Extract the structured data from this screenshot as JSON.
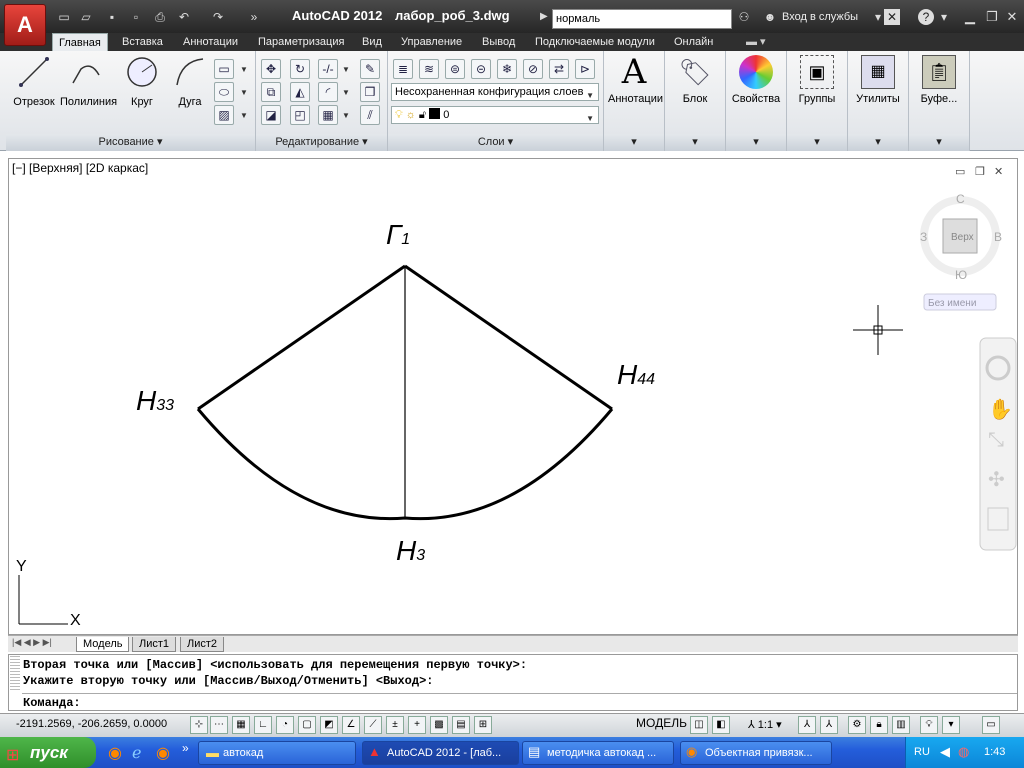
{
  "window": {
    "app_title": "AutoCAD 2012",
    "doc_title": "лабор_роб_3.dwg",
    "search_value": "нормаль",
    "login_label": "Вход в службы"
  },
  "tabs": [
    "Главная",
    "Вставка",
    "Аннотации",
    "Параметризация",
    "Вид",
    "Управление",
    "Вывод",
    "Подключаемые модули",
    "Онлайн"
  ],
  "draw_panel": {
    "title": "Рисование",
    "line": "Отрезок",
    "polyline": "Полилиния",
    "circle": "Круг",
    "arc": "Дуга"
  },
  "modify_panel": {
    "title": "Редактирование"
  },
  "layers_panel": {
    "title": "Слои",
    "layer_state": "Несохраненная конфигурация слоев",
    "current_layer": "0"
  },
  "big_buttons": {
    "annotation": "Аннотации",
    "block": "Блок",
    "properties": "Свойства",
    "groups": "Группы",
    "utilities": "Утилиты",
    "clipboard": "Буфе..."
  },
  "viewport": {
    "label": "[−] [Верхняя] [2D каркас]",
    "viewcube_top": "Верх",
    "north": "С",
    "south": "Ю",
    "west": "З",
    "east": "В",
    "ucs_name": "Без имени"
  },
  "drawing": {
    "label_top": "Г",
    "label_top_sub": "1",
    "label_left": "Н",
    "label_left_sub": "33",
    "label_right": "Н",
    "label_right_sub": "44",
    "label_bottom": "Н",
    "label_bottom_sub": "3",
    "ucs_y": "Y",
    "ucs_x": "X"
  },
  "layout_tabs": [
    "Модель",
    "Лист1",
    "Лист2"
  ],
  "command": {
    "line1": "Вторая точка или [Массив] <использовать для перемещения первую точку>:",
    "line2": "Укажите вторую точку или [Массив/Выход/Отменить] <Выход>:",
    "prompt": "Команда:"
  },
  "status": {
    "coords": "-2191.2569, -206.2659, 0.0000",
    "model": "МОДЕЛЬ",
    "scale": "1:1"
  },
  "taskbar": {
    "start": "пуск",
    "items": [
      "автокад",
      "AutoCAD 2012 - [лаб...",
      "методичка автокад ...",
      "Объектная привязк..."
    ],
    "lang": "RU",
    "time": "1:43"
  }
}
